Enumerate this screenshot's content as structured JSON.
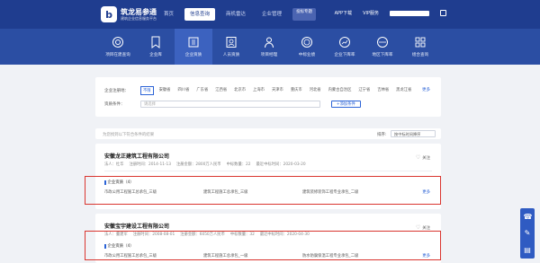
{
  "header": {
    "logo_mark": "b",
    "logo_title": "筑龙易参通",
    "logo_subtitle": "建筑企业信息服务平台",
    "nav": [
      {
        "label": "首页",
        "active": false
      },
      {
        "label": "信息查询",
        "active": true
      },
      {
        "label": "商机雷达",
        "active": false
      },
      {
        "label": "企业管理",
        "active": false
      },
      {
        "label": "投标专题",
        "active": false,
        "badge": true
      }
    ],
    "app_download": "APP下载",
    "vip_service": "VIP服务"
  },
  "categories": [
    {
      "label": "项目在建查询",
      "icon": "target-icon",
      "active": false
    },
    {
      "label": "企业库",
      "icon": "bookmark-icon",
      "active": false
    },
    {
      "label": "企业资质",
      "icon": "book-icon",
      "active": true
    },
    {
      "label": "人员资质",
      "icon": "id-card-icon",
      "active": false
    },
    {
      "label": "项目经理",
      "icon": "person-icon",
      "active": false
    },
    {
      "label": "中标业绩",
      "icon": "medal-icon",
      "active": false
    },
    {
      "label": "企业下库率",
      "icon": "chart-icon",
      "active": false
    },
    {
      "label": "地区下库率",
      "icon": "globe-icon",
      "active": false
    },
    {
      "label": "组合查询",
      "icon": "grid-icon",
      "active": false
    }
  ],
  "filter": {
    "region_label": "企业注册地：",
    "regions": [
      "不限",
      "安徽省",
      "四川省",
      "广东省",
      "江西省",
      "北京市",
      "上海市",
      "天津市",
      "重庆市",
      "河北省",
      "内蒙古自治区",
      "辽宁省",
      "吉林省",
      "黑龙江省"
    ],
    "selected_region": "不限",
    "more_label": "更多",
    "qual_label": "资质条件：",
    "qual_placeholder": "请选择",
    "add_button": "+添加条件"
  },
  "results": {
    "hint": "为您找到以下符合条件的结果",
    "sort_label": "排序:",
    "sort_value": "按中标时间降序"
  },
  "companies": [
    {
      "name": "安徽龙正建筑工程有限公司",
      "legal_person": "法人：杜华",
      "reg_time": "注册时间：2014-11-13",
      "capital": "注册金额：2800万人民币",
      "bids": "中标数量：22",
      "last_bid": "最近中标时间：2020-03-20",
      "follow": "关注",
      "qual_title": "企业资质（4）",
      "quals": [
        "市政公用工程施工总承包_三级",
        "建筑工程施工总承包_三级",
        "建筑装修装饰工程专业承包_二级"
      ],
      "more": "更多"
    },
    {
      "name": "安徽宝宇建设工程有限公司",
      "legal_person": "法人：董建军",
      "reg_time": "注册时间：2008-08-01",
      "capital": "注册金额：6050万人民币",
      "bids": "中标数量：32",
      "last_bid": "最近中标时间：2020-04-30",
      "follow": "关注",
      "qual_title": "企业资质（4）",
      "quals": [
        "市政公用工程施工总承包_三级",
        "建筑工程施工总承包_一级",
        "防水防腐保温工程专业承包_二级"
      ],
      "more": "更多"
    }
  ],
  "colors": {
    "topbar": "#1f3d8f",
    "band": "#2b4ea3",
    "accent": "#2b63d6",
    "highlight_box": "#d9352f"
  }
}
